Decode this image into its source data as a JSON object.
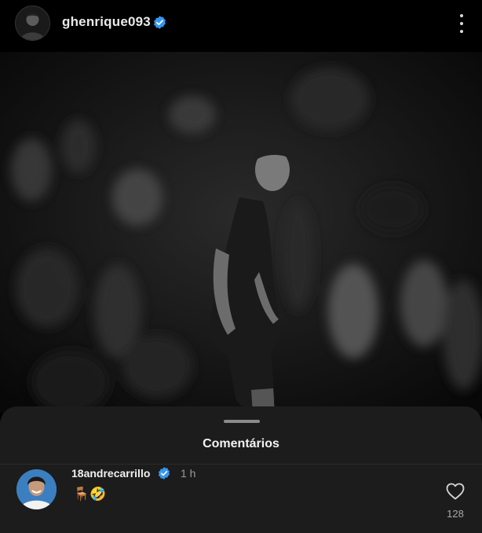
{
  "post": {
    "username": "ghenrique093",
    "verified_icon": "verified-badge-icon",
    "more_icon": "more-vertical-icon"
  },
  "comments_sheet": {
    "title": "Comentários"
  },
  "comments": [
    {
      "username": "18andrecarrillo",
      "time": "1 h",
      "text": "🪑🤣",
      "likes": "128",
      "like_icon": "heart-outline-icon"
    }
  ],
  "colors": {
    "background": "#000000",
    "sheet": "#1c1c1c",
    "verified": "#3797f0",
    "muted_text": "#9a9a9a"
  }
}
